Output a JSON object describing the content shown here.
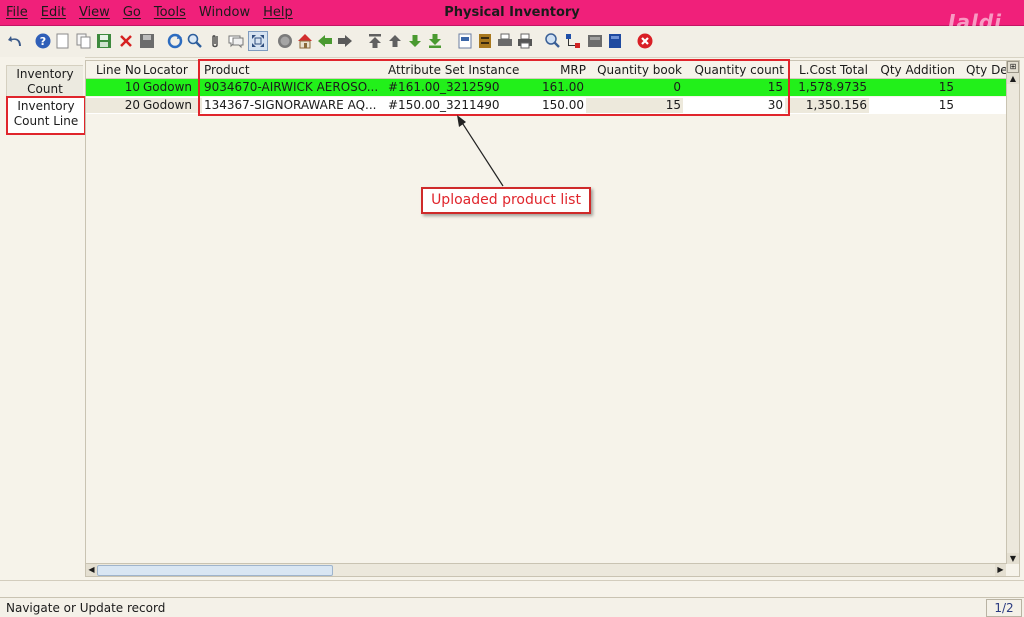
{
  "window": {
    "title": "Physical Inventory",
    "brand": "Jaldi"
  },
  "menu": [
    "File",
    "Edit",
    "View",
    "Go",
    "Tools",
    "Window",
    "Help"
  ],
  "toolbar": {
    "icons": [
      "undo-icon",
      "help-icon",
      "new-record-icon",
      "copy-record-icon",
      "save-icon",
      "delete-icon",
      "save-disk-icon",
      "refresh-icon",
      "find-icon",
      "attachment-icon",
      "chat-icon",
      "grid-toggle-icon",
      "history-icon",
      "home-icon",
      "back-icon",
      "forward-icon",
      "first-record-icon",
      "previous-record-icon",
      "next-record-icon",
      "last-record-icon",
      "report-icon",
      "archive-icon",
      "print-preview-icon",
      "print-icon",
      "zoom-across-icon",
      "workflow-icon",
      "request-icon",
      "product-info-icon",
      "close-window-icon"
    ]
  },
  "tabs": [
    {
      "label_line1": "Inventory",
      "label_line2": "Count"
    },
    {
      "label_line1": "Inventory",
      "label_line2": "Count Line"
    }
  ],
  "grid": {
    "columns": [
      "Line No",
      "Locator",
      "Product",
      "Attribute Set Instance",
      "MRP",
      "Quantity book",
      "Quantity count",
      "L.Cost Total",
      "Qty Addition",
      "Qty Dec"
    ],
    "rows": [
      {
        "line": "10",
        "locator": "Godown",
        "product": "9034670-AIRWICK AEROSO...",
        "asi": "#161.00_3212590",
        "mrp": "161.00",
        "qty_book": "0",
        "qty_count": "15",
        "lcost": "1,578.9735",
        "qty_add": "15",
        "qty_dec": ""
      },
      {
        "line": "20",
        "locator": "Godown",
        "product": "134367-SIGNORAWARE AQ...",
        "asi": "#150.00_3211490",
        "mrp": "150.00",
        "qty_book": "15",
        "qty_count": "30",
        "lcost": "1,350.156",
        "qty_add": "15",
        "qty_dec": ""
      }
    ]
  },
  "annotation": {
    "callout_text": "Uploaded product list"
  },
  "status": {
    "message": "Navigate or Update record",
    "page": "1/2"
  },
  "colors": {
    "title_bar": "#f0207a",
    "selected_row": "#22f01a",
    "annotation_red": "#e0252c"
  }
}
